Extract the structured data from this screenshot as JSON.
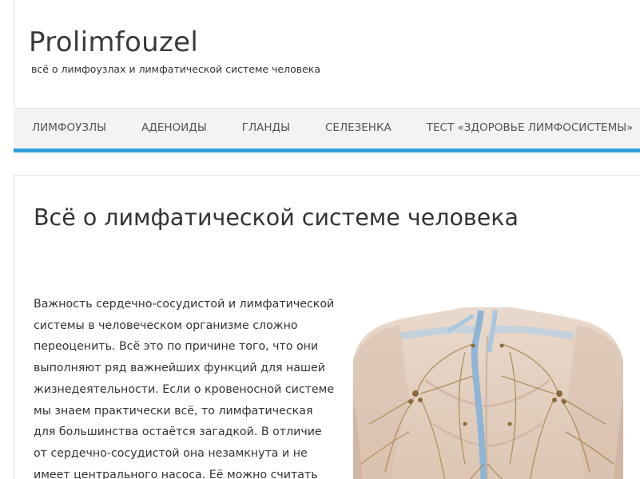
{
  "site": {
    "title": "Prolimfouzel",
    "description": "всё о лимфоузлах и лимфатической системе человека"
  },
  "nav": {
    "items": [
      {
        "label": "ЛИМФОУЗЛЫ"
      },
      {
        "label": "АДЕНОИДЫ"
      },
      {
        "label": "ГЛАНДЫ"
      },
      {
        "label": "СЕЛЕЗЕНКА"
      },
      {
        "label": "ТЕСТ «ЗДОРОВЬЕ ЛИМФОСИСТЕМЫ»"
      }
    ],
    "accent_color": "#2e9fd9"
  },
  "article": {
    "title": "Всё о лимфатической системе человека",
    "lines": [
      "Важность сердечно-сосудистой и лимфатической",
      "системы в человеческом организме сложно",
      "переоценить. Всё  это по причине того, что они",
      "выполняют ряд важнейших функций для нашей",
      "жизнедеятельности. Если о кровеносной системе",
      "мы знаем практически всё, то лимфатическая",
      "для большинства остаётся загадкой.  В отличие",
      "от сердечно-сосудистой она незамкнута и не",
      "имеет центрального насоса. Её можно считать"
    ],
    "image_icon": "lymphatic-system-anatomy-image"
  }
}
